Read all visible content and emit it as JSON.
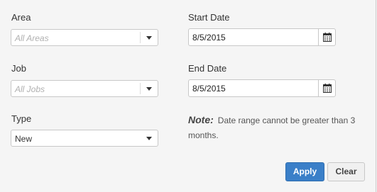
{
  "area": {
    "label": "Area",
    "placeholder": "All Areas"
  },
  "job": {
    "label": "Job",
    "placeholder": "All Jobs"
  },
  "type": {
    "label": "Type",
    "value": "New"
  },
  "start_date": {
    "label": "Start Date",
    "value": "8/5/2015"
  },
  "end_date": {
    "label": "End Date",
    "value": "8/5/2015"
  },
  "note": {
    "title": "Note:",
    "text": "Date range cannot be greater than 3 months."
  },
  "buttons": {
    "apply": "Apply",
    "clear": "Clear"
  },
  "icons": {
    "dropdown": "chevron-down-icon",
    "calendar": "calendar-icon"
  },
  "colors": {
    "primary": "#3a7fc8",
    "background": "#f5f5f5"
  }
}
